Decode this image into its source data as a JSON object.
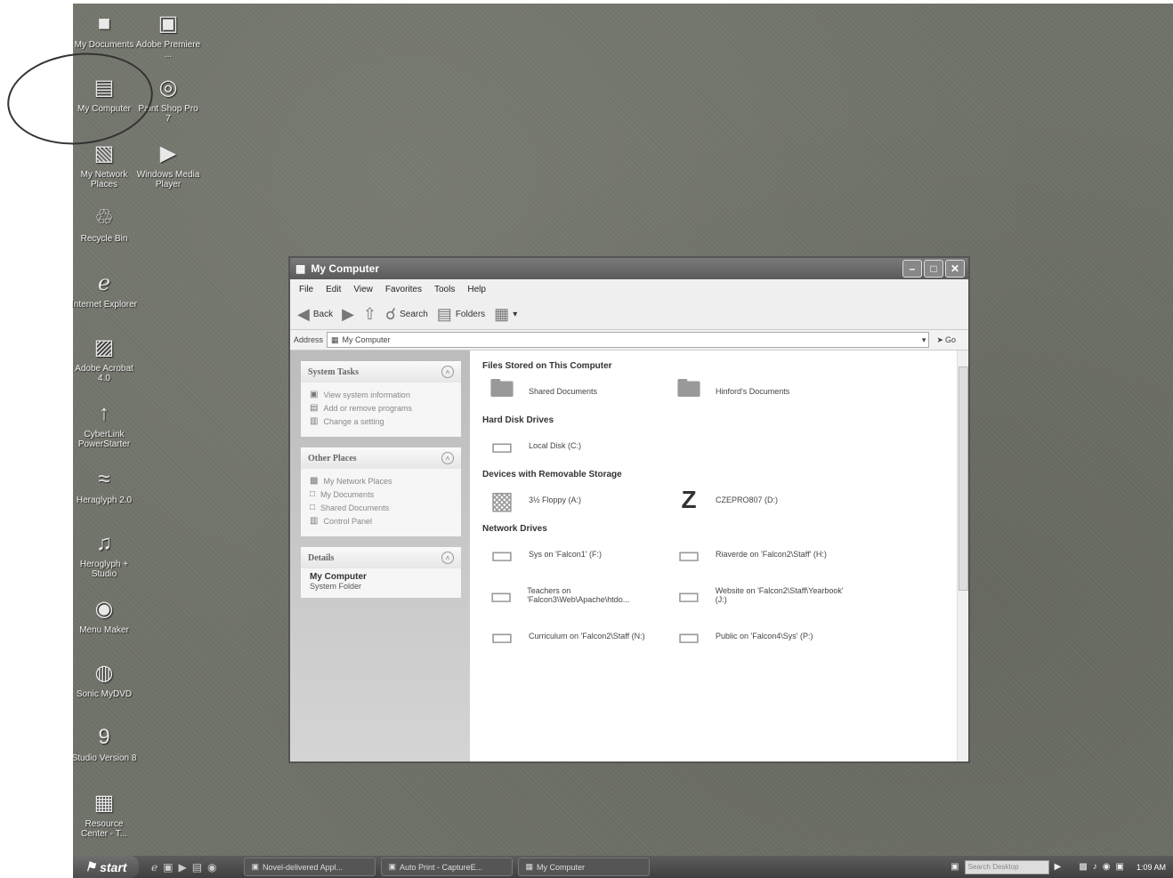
{
  "desktop": {
    "icons": [
      {
        "label": "My Documents",
        "glyph": "■"
      },
      {
        "label": "Adobe Premiere ...",
        "glyph": "▣"
      },
      {
        "label": "My Computer",
        "glyph": "▤"
      },
      {
        "label": "Paint Shop Pro 7",
        "glyph": "◎"
      },
      {
        "label": "My Network Places",
        "glyph": "▧"
      },
      {
        "label": "Windows Media Player",
        "glyph": "▶"
      },
      {
        "label": "Recycle Bin",
        "glyph": "♲"
      },
      {
        "label": "Internet Explorer",
        "glyph": "ℯ"
      },
      {
        "label": "Adobe Acrobat 4.0",
        "glyph": "▨"
      },
      {
        "label": "CyberLink PowerStarter",
        "glyph": "↑"
      },
      {
        "label": "Heraglyph 2.0",
        "glyph": "≈"
      },
      {
        "label": "Heroglyph + Studio",
        "glyph": "♫"
      },
      {
        "label": "Menu Maker",
        "glyph": "◉"
      },
      {
        "label": "Sonic MyDVD",
        "glyph": "◍"
      },
      {
        "label": "Studio Version 8",
        "glyph": "9"
      },
      {
        "label": "Resource Center - T...",
        "glyph": "▦"
      }
    ]
  },
  "window": {
    "title": "My Computer",
    "menu": [
      "File",
      "Edit",
      "View",
      "Favorites",
      "Tools",
      "Help"
    ],
    "toolbar": {
      "back": "Back",
      "search": "Search",
      "folders": "Folders"
    },
    "address": {
      "label": "Address",
      "value": "My Computer",
      "go": "Go"
    },
    "left": {
      "system_tasks": {
        "title": "System Tasks",
        "items": [
          "View system information",
          "Add or remove programs",
          "Change a setting"
        ]
      },
      "other_places": {
        "title": "Other Places",
        "items": [
          "My Network Places",
          "My Documents",
          "Shared Documents",
          "Control Panel"
        ]
      },
      "details": {
        "title": "Details",
        "name": "My Computer",
        "type": "System Folder"
      }
    },
    "sections": {
      "files": {
        "title": "Files Stored on This Computer",
        "items": [
          "Shared Documents",
          "Hinford's Documents"
        ]
      },
      "hard": {
        "title": "Hard Disk Drives",
        "items": [
          "Local Disk (C:)"
        ]
      },
      "removable": {
        "title": "Devices with Removable Storage",
        "items": [
          "3½ Floppy (A:)",
          "CZEPRO807 (D:)"
        ]
      },
      "network": {
        "title": "Network Drives",
        "items": [
          "Sys on 'Falcon1' (F:)",
          "Riaverde on 'Falcon2\\Staff' (H:)",
          "Teachers on 'Falcon3\\Web\\Apache\\htdo...",
          "Website on 'Falcon2\\Staff\\Yearbook' (J:)",
          "Curriculum on 'Falcon2\\Staff (N:)",
          "Public on 'Falcon4\\Sys' (P:)"
        ]
      }
    }
  },
  "taskbar": {
    "start": "start",
    "tasks": [
      "Novel-delivered Appl...",
      "Auto Print - CaptureE...",
      "My Computer"
    ],
    "search_placeholder": "Search Desktop",
    "clock": "1:09 AM"
  }
}
